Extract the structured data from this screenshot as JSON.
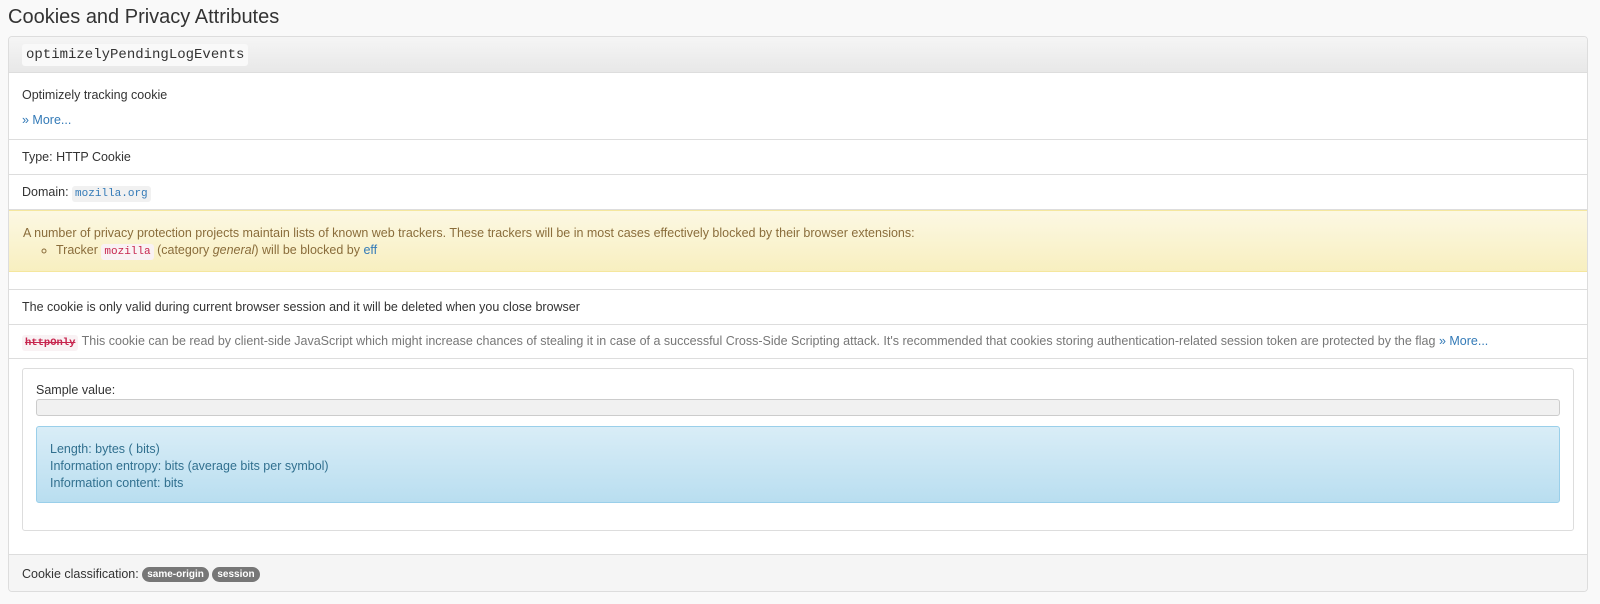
{
  "page": {
    "title": "Cookies and Privacy Attributes"
  },
  "cookie": {
    "name": "optimizelyPendingLogEvents",
    "description": "Optimizely tracking cookie",
    "more_link": "» More...",
    "type_label": "Type:",
    "type_value": "HTTP Cookie",
    "domain_label": "Domain:",
    "domain_value": "mozilla.org"
  },
  "privacy_alert": {
    "intro": "A number of privacy protection projects maintain lists of known web trackers. These trackers will be in most cases effectively blocked by their browser extensions:",
    "tracker_prefix": "Tracker",
    "tracker_name": "mozilla",
    "category_prefix": "(category",
    "category_name": "general",
    "category_suffix": ") will be blocked by",
    "blocker_link": "eff"
  },
  "session_note": "The cookie is only valid during current browser session and it will be deleted when you close browser",
  "httponly": {
    "flag": "httpOnly",
    "text": "This cookie can be read by client-side JavaScript which might increase chances of stealing it in case of a successful Cross-Side Scripting attack. It's recommended that cookies storing authentication-related session token are protected by the flag",
    "more_link": "» More..."
  },
  "sample": {
    "label": "Sample value:",
    "value": "",
    "length_line": "Length: bytes ( bits)",
    "entropy_line": "Information entropy: bits (average bits per symbol)",
    "content_line": "Information content: bits"
  },
  "classification": {
    "label": "Cookie classification:",
    "badges": [
      "same-origin",
      "session"
    ]
  },
  "colors": {
    "link": "#337ab7",
    "warning_text": "#8a6d3b",
    "info_text": "#31708f",
    "badge_bg": "#777777"
  }
}
